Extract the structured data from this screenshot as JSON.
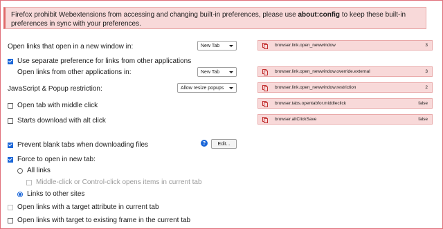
{
  "banner": {
    "text_before": "Firefox prohibit Webextensions from accessing and changing built-in preferences, please use ",
    "text_bold": "about:config",
    "text_after": " to keep these built-in preferences in sync with your preferences."
  },
  "settings": {
    "open_new_window_label": "Open links that open in a new window in:",
    "open_new_window_value": "New Tab",
    "use_separate_label": "Use separate preference for links from other applications",
    "other_apps_label": "Open links from other applications in:",
    "other_apps_value": "New Tab",
    "js_popup_label": "JavaScript & Popup restriction:",
    "js_popup_value": "Allow resize popups",
    "middle_click_label": "Open tab with middle click",
    "alt_click_label": "Starts download with alt click",
    "prevent_blank_label": "Prevent blank tabs when downloading files",
    "help_icon_text": "?",
    "edit_button": "Edit...",
    "force_open_label": "Force to open in new tab:",
    "all_links_label": "All links",
    "middle_click_opens_label": "Middle-click or Control-click opens items in current tab",
    "links_other_sites_label": "Links to other sites",
    "target_attr_label": "Open links with a target attribute in current tab",
    "target_existing_label": "Open links with target to existing frame in the current tab"
  },
  "prefs": [
    {
      "name": "browser.link.open_newwindow",
      "value": "3"
    },
    {
      "name": "browser.link.open_newwindow.override.external",
      "value": "3"
    },
    {
      "name": "browser.link.open_newwindow.restriction",
      "value": "2"
    },
    {
      "name": "browser.tabs.opentabfor.middleclick",
      "value": "false"
    },
    {
      "name": "browser.altClickSave",
      "value": "false"
    }
  ]
}
